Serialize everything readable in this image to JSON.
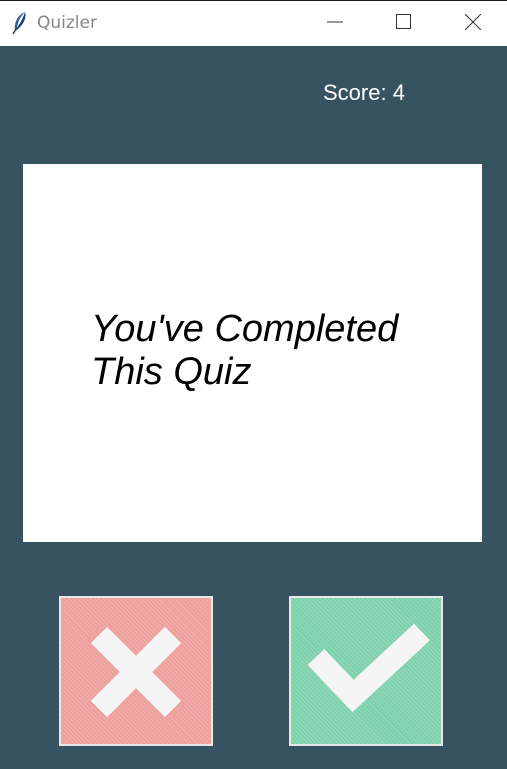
{
  "window": {
    "title": "Quizler",
    "icons": {
      "app": "feather-icon",
      "minimize": "minimize-icon",
      "maximize": "maximize-icon",
      "close": "close-icon"
    }
  },
  "score": {
    "label": "Score: 4"
  },
  "question": {
    "text": "You've Completed This Quiz"
  },
  "buttons": {
    "false_icon": "cross-icon",
    "true_icon": "checkmark-icon"
  },
  "colors": {
    "background": "#375362",
    "card": "#ffffff",
    "false_button": "#ee9f9c",
    "true_button": "#7ed1ad"
  }
}
